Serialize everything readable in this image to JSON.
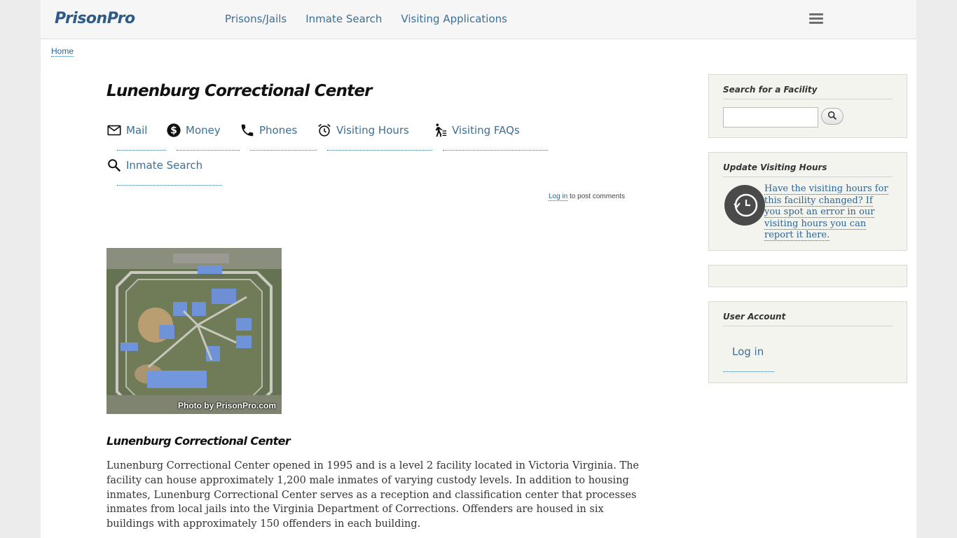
{
  "header": {
    "logo": "PrisonPro",
    "nav": [
      "Prisons/Jails",
      "Inmate Search",
      "Visiting Applications"
    ]
  },
  "breadcrumb": {
    "home": "Home"
  },
  "main": {
    "title": "Lunenburg Correctional Center",
    "tabs": [
      {
        "label": "Mail",
        "icon": "mail-icon"
      },
      {
        "label": "Money",
        "icon": "money-icon"
      },
      {
        "label": "Phones",
        "icon": "phone-icon"
      },
      {
        "label": "Visiting Hours",
        "icon": "alarm-clock-icon"
      },
      {
        "label": "Visiting FAQs",
        "icon": "visitor-walking-icon"
      },
      {
        "label": "Inmate Search",
        "icon": "search-icon"
      }
    ],
    "login_note": {
      "link": "Log in",
      "text": "to post comments"
    },
    "photo_caption": "Photo by PrisonPro.com",
    "subtitle": "Lunenburg Correctional Center",
    "description": "Lunenburg Correctional Center opened in 1995 and is a level 2 facility located in Victoria Virginia.  The facility can house approximately 1,200 male inmates of varying custody levels.  In addition to housing inmates, Lunenburg Correctional Center serves as a reception and classification center that processes inmates from local jails into the Virginia Department of Corrections.  Offenders are housed in six buildings with approximately 150 offenders in each building."
  },
  "sidebar": {
    "search": {
      "title": "Search for a Facility",
      "value": ""
    },
    "update": {
      "title": "Update Visiting Hours",
      "link": "Have the visiting hours for this facility changed?  If you spot an error in our visiting hours you can report it here."
    },
    "account": {
      "title": "User Account",
      "login": "Log in"
    }
  },
  "colors": {
    "link": "#3d6f95",
    "logo": "#2f5a86",
    "sidebar_bg": "#f4f4ef"
  }
}
